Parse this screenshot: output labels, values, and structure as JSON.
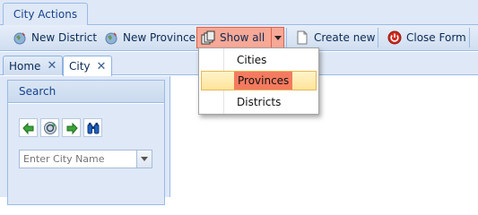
{
  "ribbon": {
    "tab_label": "City Actions"
  },
  "toolbar": {
    "new_district": "New District",
    "new_province": "New Province",
    "show_all": "Show all",
    "create_new": "Create new",
    "close_form": "Close Form"
  },
  "menu": {
    "items": [
      "Cities",
      "Provinces",
      "Districts"
    ],
    "highlighted": "Provinces"
  },
  "doc_tabs": [
    {
      "label": "Home"
    },
    {
      "label": "City"
    }
  ],
  "search": {
    "title": "Search",
    "placeholder": "Enter City Name",
    "tools": [
      "back-icon",
      "reset-icon",
      "forward-icon",
      "binoculars-icon"
    ]
  },
  "colors": {
    "highlight": "#f47a5f",
    "panel": "#dfe8f6",
    "border": "#99bbe8"
  }
}
